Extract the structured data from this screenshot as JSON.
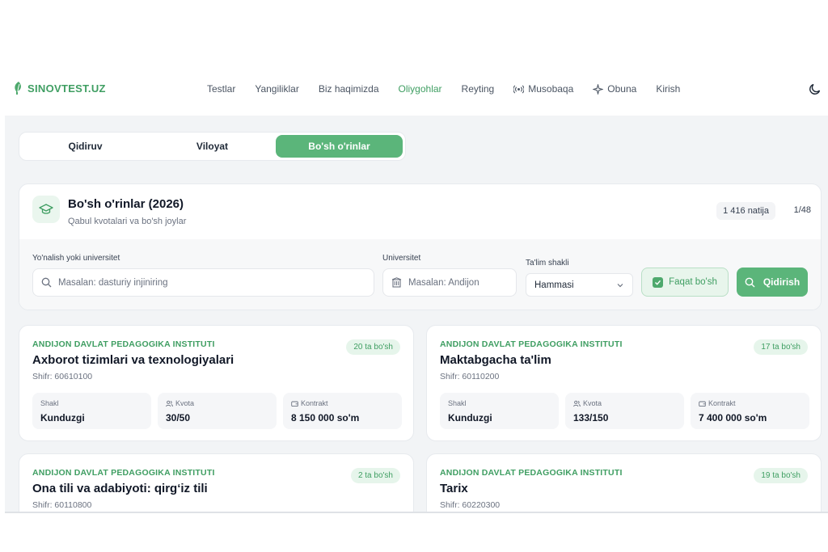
{
  "brand": {
    "logo_text": "SINOVTEST.UZ",
    "accent": "#3f9e62"
  },
  "nav": {
    "items": [
      {
        "label": "Testlar"
      },
      {
        "label": "Yangiliklar"
      },
      {
        "label": "Biz haqimizda"
      },
      {
        "label": "Oliygohlar"
      },
      {
        "label": "Reyting"
      },
      {
        "label": "Musobaqa"
      },
      {
        "label": "Obuna"
      },
      {
        "label": "Kirish"
      }
    ],
    "active": "Oliygohlar"
  },
  "tabs": [
    {
      "label": "Qidiruv"
    },
    {
      "label": "Viloyat"
    },
    {
      "label": "Bo'sh o'rinlar"
    }
  ],
  "panel": {
    "title": "Bo'sh o'rinlar (2026)",
    "subtitle": "Qabul kvotalari va bo'sh joylar",
    "results": "1 416 natija",
    "pages": "1/48"
  },
  "filters": {
    "direction_label": "Yo'nalish yoki universitet",
    "direction_placeholder": "Masalan: dasturiy injiniring",
    "university_label": "Universitet",
    "university_placeholder": "Masalan: Andijon",
    "form_label": "Ta'lim shakli",
    "form_value": "Hammasi",
    "only_vacant_label": "Faqat bo'sh",
    "search_label": "Qidirish"
  },
  "cards": [
    {
      "university": "ANDIJON DAVLAT PEDAGOGIKA INSTITUTI",
      "badge": "20 ta bo'sh",
      "title": "Axborot tizimlari va texnologiyalari",
      "code": "Shifr: 60610100",
      "stats": [
        {
          "label": "Shakl",
          "value": "Kunduzgi"
        },
        {
          "label": "Kvota",
          "value": "30/50"
        },
        {
          "label": "Kontrakt",
          "value": "8 150 000 so'm"
        }
      ]
    },
    {
      "university": "ANDIJON DAVLAT PEDAGOGIKA INSTITUTI",
      "badge": "17 ta bo'sh",
      "title": "Maktabgacha ta'lim",
      "code": "Shifr: 60110200",
      "stats": [
        {
          "label": "Shakl",
          "value": "Kunduzgi"
        },
        {
          "label": "Kvota",
          "value": "133/150"
        },
        {
          "label": "Kontrakt",
          "value": "7 400 000 so'm"
        }
      ]
    },
    {
      "university": "ANDIJON DAVLAT PEDAGOGIKA INSTITUTI",
      "badge": "2 ta bo'sh",
      "title": "Ona tili va adabiyoti: qirg‘iz tili",
      "code": "Shifr: 60110800"
    },
    {
      "university": "ANDIJON DAVLAT PEDAGOGIKA INSTITUTI",
      "badge": "19 ta bo'sh",
      "title": "Tarix",
      "code": "Shifr: 60220300"
    }
  ]
}
